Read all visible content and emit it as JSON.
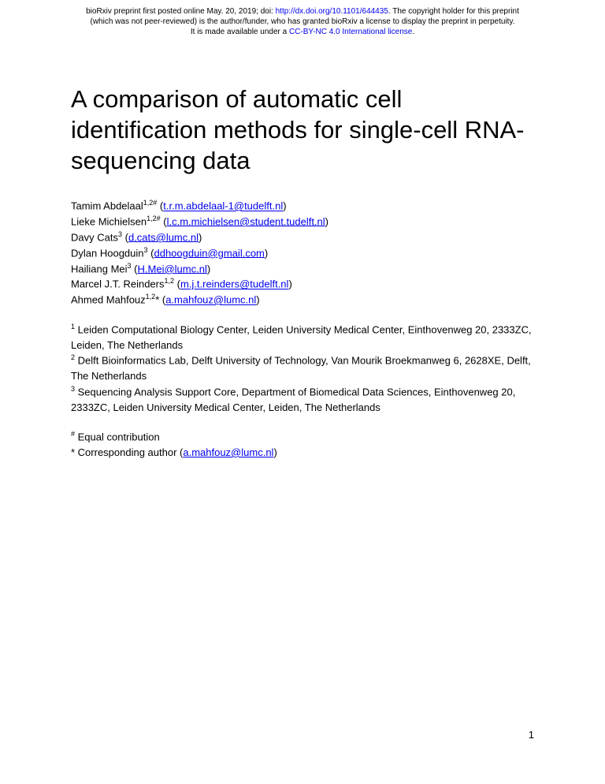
{
  "preprint": {
    "line1_prefix": "bioRxiv preprint first posted online May. 20, 2019; doi: ",
    "doi_link": "http://dx.doi.org/10.1101/644435",
    "line1_suffix": ". The copyright holder for this preprint",
    "line2": "(which was not peer-reviewed) is the author/funder, who has granted bioRxiv a license to display the preprint in perpetuity.",
    "line3_prefix": "It is made available under a ",
    "license_link": "CC-BY-NC 4.0 International license",
    "line3_suffix": "."
  },
  "title": "A comparison of automatic cell identification methods for single-cell RNA-sequencing data",
  "authors": [
    {
      "name": "Tamim Abdelaal",
      "sup": "1,2#",
      "email": "t.r.m.abdelaal-1@tudelft.nl"
    },
    {
      "name": "Lieke Michielsen",
      "sup": "1,2#",
      "email": "l.c.m.michielsen@student.tudelft.nl"
    },
    {
      "name": "Davy Cats",
      "sup": "3",
      "email": "d.cats@lumc.nl"
    },
    {
      "name": "Dylan Hoogduin",
      "sup": "3",
      "email": "ddhoogduin@gmail.com"
    },
    {
      "name": "Hailiang Mei",
      "sup": "3",
      "email": "H.Mei@lumc.nl"
    },
    {
      "name": "Marcel J.T. Reinders",
      "sup": "1,2",
      "email": "m.j.t.reinders@tudelft.nl"
    },
    {
      "name": "Ahmed Mahfouz",
      "sup": "1,2",
      "suffix": "*",
      "email": "a.mahfouz@lumc.nl"
    }
  ],
  "affiliations": [
    {
      "num": "1",
      "text": " Leiden Computational Biology Center, Leiden University Medical Center, Einthovenweg 20, 2333ZC, Leiden, The Netherlands"
    },
    {
      "num": "2",
      "text": " Delft Bioinformatics Lab, Delft University of Technology, Van Mourik Broekmanweg 6, 2628XE, Delft, The Netherlands"
    },
    {
      "num": "3",
      "text": " Sequencing Analysis Support Core, Department of Biomedical Data Sciences, Einthovenweg 20, 2333ZC, Leiden University Medical Center, Leiden, The Netherlands"
    }
  ],
  "notes": {
    "equal_sup": "#",
    "equal_text": " Equal contribution",
    "corresponding_prefix": "* Corresponding author (",
    "corresponding_email": "a.mahfouz@lumc.nl",
    "corresponding_suffix": ")"
  },
  "page_number": "1"
}
